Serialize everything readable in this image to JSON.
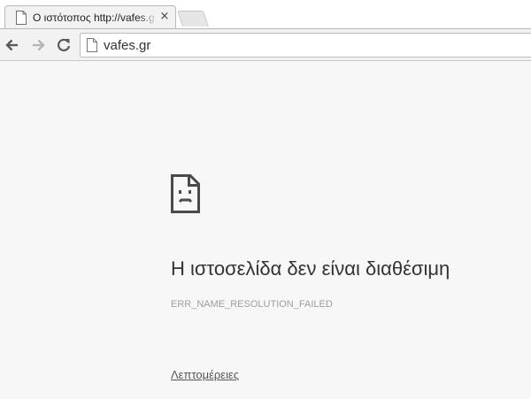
{
  "browser": {
    "tab": {
      "title": "Ο ιστότοπος http://vafes.gr",
      "icon": "page-icon",
      "close_label": "×"
    },
    "toolbar": {
      "back_icon": "back-arrow-icon",
      "forward_icon": "forward-arrow-icon",
      "reload_icon": "reload-icon",
      "address": "vafes.gr"
    }
  },
  "error_page": {
    "icon": "sad-page-icon",
    "heading": "Η ιστοσελίδα δεν είναι διαθέσιμη",
    "error_code": "ERR_NAME_RESOLUTION_FAILED",
    "details_link": "Λεπτομέρειες"
  },
  "colors": {
    "page_background": "#f7f7f7",
    "heading": "#333333",
    "error_code": "#9e9e9e"
  }
}
